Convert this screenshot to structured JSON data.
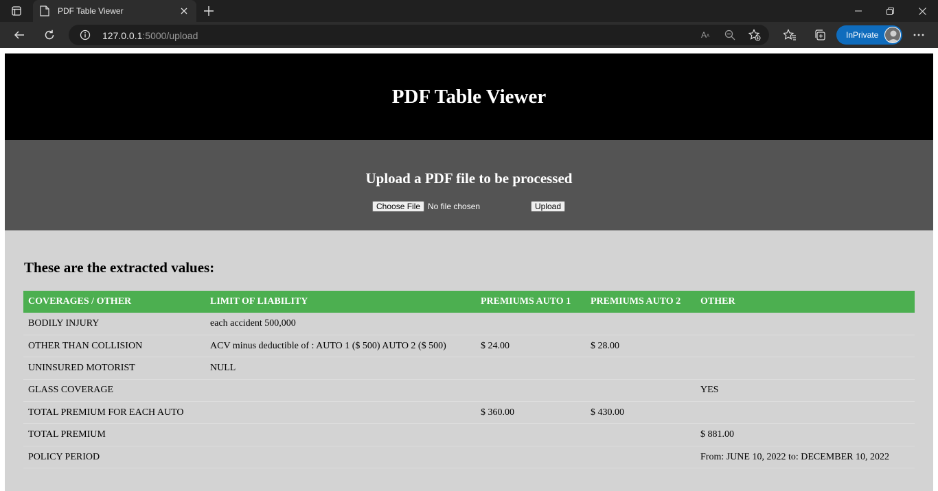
{
  "browser": {
    "tab_title": "PDF Table Viewer",
    "url_host": "127.0.0.1",
    "url_path": ":5000/upload",
    "inprivate_label": "InPrivate"
  },
  "page": {
    "header_title": "PDF Table Viewer",
    "upload_heading": "Upload a PDF file to be processed",
    "choose_file_label": "Choose File",
    "file_status": "No file chosen",
    "upload_button_label": "Upload",
    "results_heading": "These are the extracted values:"
  },
  "table": {
    "headers": [
      "COVERAGES / OTHER",
      "LIMIT OF LIABILITY",
      "PREMIUMS AUTO 1",
      "PREMIUMS AUTO 2",
      "OTHER"
    ],
    "rows": [
      [
        "BODILY INJURY",
        "each accident 500,000",
        "",
        "",
        ""
      ],
      [
        "OTHER THAN COLLISION",
        "ACV minus deductible of : AUTO 1 ($ 500) AUTO 2 ($ 500)",
        "$ 24.00",
        "$ 28.00",
        ""
      ],
      [
        "UNINSURED MOTORIST",
        "NULL",
        "",
        "",
        ""
      ],
      [
        "GLASS COVERAGE",
        "",
        "",
        "",
        "YES"
      ],
      [
        "TOTAL PREMIUM FOR EACH AUTO",
        "",
        "$ 360.00",
        "$ 430.00",
        ""
      ],
      [
        "TOTAL PREMIUM",
        "",
        "",
        "",
        "$ 881.00"
      ],
      [
        "POLICY PERIOD",
        "",
        "",
        "",
        "From: JUNE 10, 2022 to: DECEMBER 10, 2022"
      ]
    ]
  },
  "colors": {
    "header_bg": "#000000",
    "upload_bg": "#545454",
    "page_bg": "#d3d3d3",
    "table_header_bg": "#4caf50"
  },
  "icons": [
    "tab-actions-icon",
    "pdf-favicon-icon",
    "close-icon",
    "plus-icon",
    "minimize-icon",
    "restore-icon",
    "window-close-icon",
    "back-arrow-icon",
    "refresh-icon",
    "info-icon",
    "read-aloud-icon",
    "zoom-out-icon",
    "add-favorite-icon",
    "favorites-icon",
    "collections-icon",
    "more-icon"
  ]
}
